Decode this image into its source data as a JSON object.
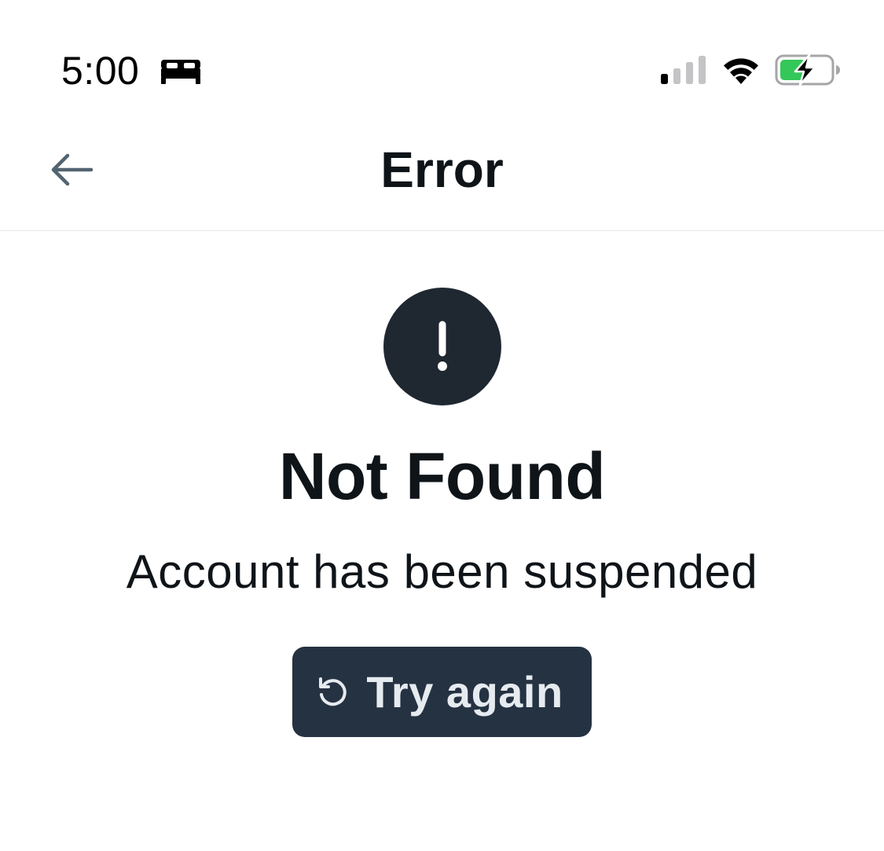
{
  "status_bar": {
    "time": "5:00",
    "icons": [
      "sleep-focus-icon",
      "cellular-signal-icon",
      "wifi-icon",
      "battery-charging-icon"
    ]
  },
  "header": {
    "title": "Error",
    "back_icon": "arrow-left-icon"
  },
  "error": {
    "icon": "exclamation-icon",
    "title": "Not Found",
    "message": "Account has been suspended"
  },
  "retry_button": {
    "label": "Try again",
    "icon": "refresh-icon"
  },
  "colors": {
    "text_primary": "#0f1419",
    "icon_circle": "#1f2731",
    "button_background": "#253242",
    "button_text": "#e6ebf0",
    "back_arrow": "#536471",
    "battery_fill": "#34c759",
    "divider": "#e3e6e9"
  }
}
